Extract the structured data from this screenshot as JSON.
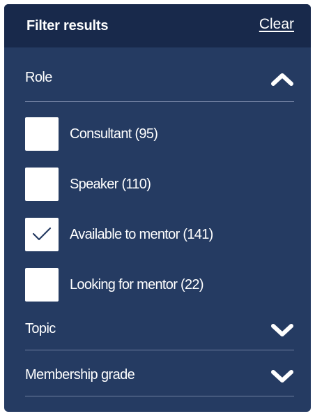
{
  "header": {
    "title": "Filter results",
    "clear_label": "Clear"
  },
  "sections": [
    {
      "label": "Role",
      "expanded": true,
      "chevron_icon": "chevron-up-icon",
      "options": [
        {
          "label": "Consultant (95)",
          "checked": false
        },
        {
          "label": "Speaker (110)",
          "checked": false
        },
        {
          "label": "Available to mentor (141)",
          "checked": true
        },
        {
          "label": "Looking for mentor (22)",
          "checked": false
        }
      ]
    },
    {
      "label": "Topic",
      "expanded": false,
      "chevron_icon": "chevron-down-icon"
    },
    {
      "label": "Membership grade",
      "expanded": false,
      "chevron_icon": "chevron-down-icon"
    }
  ],
  "colors": {
    "panel_background": "#253b62",
    "header_background": "#18294b",
    "divider": "#6f7fa0",
    "text": "#ffffff",
    "checkbox": "#ffffff",
    "checkmark": "#253b62"
  }
}
